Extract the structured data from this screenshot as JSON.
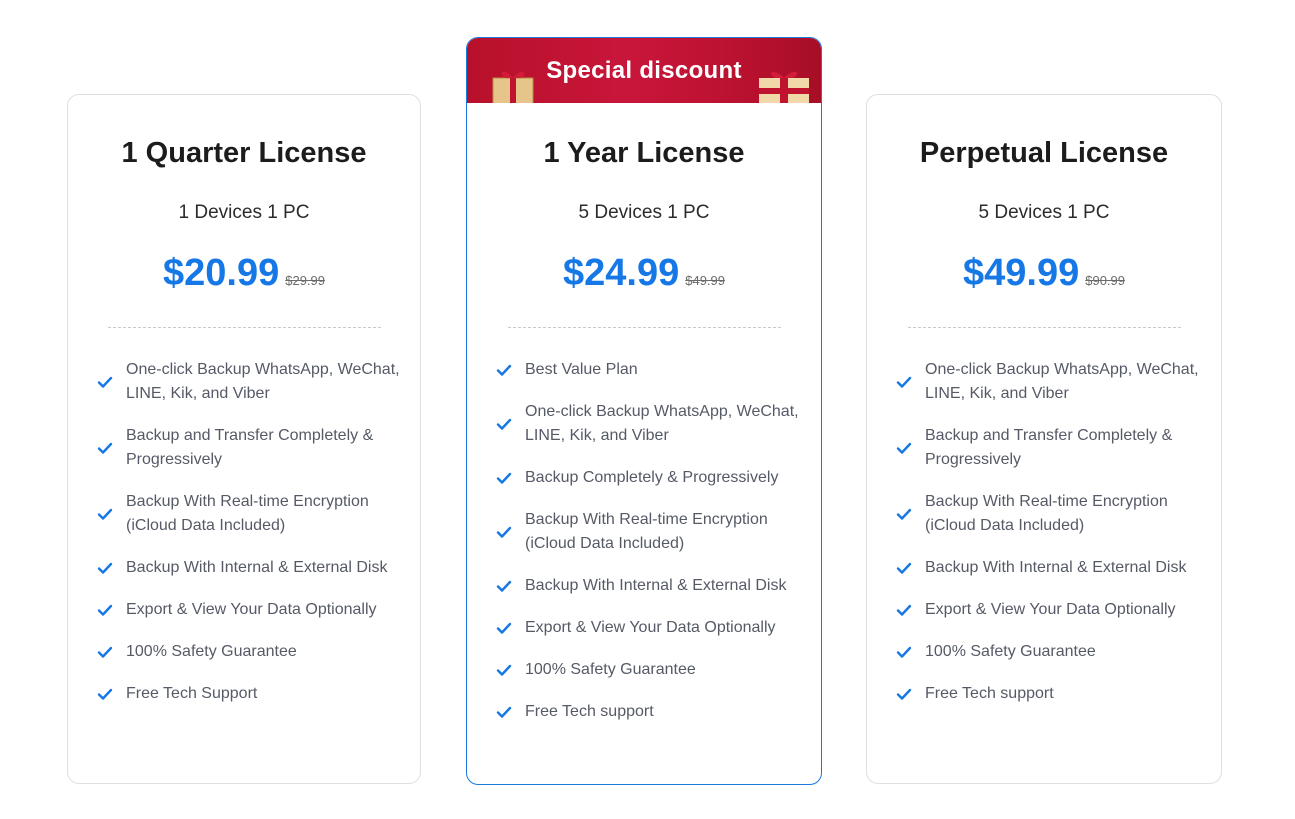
{
  "plans": [
    {
      "title": "1 Quarter License",
      "devices": "1 Devices 1 PC",
      "price": "$20.99",
      "old_price": "$29.99",
      "features": [
        "One-click Backup WhatsApp, WeChat, LINE, Kik, and Viber",
        "Backup and Transfer Completely & Progressively",
        "Backup With Real-time Encryption (iCloud Data Included)",
        "Backup With Internal & External Disk",
        "Export & View Your Data Optionally",
        "100% Safety Guarantee",
        "Free Tech Support"
      ]
    },
    {
      "banner": "Special discount",
      "title": "1 Year License",
      "devices": "5 Devices 1 PC",
      "price": "$24.99",
      "old_price": "$49.99",
      "features": [
        "Best Value Plan",
        "One-click Backup WhatsApp, WeChat, LINE, Kik, and Viber",
        "Backup Completely & Progressively",
        "Backup With Real-time Encryption (iCloud Data Included)",
        "Backup With Internal & External Disk",
        "Export & View Your Data Optionally",
        "100% Safety Guarantee",
        "Free Tech support"
      ]
    },
    {
      "title": "Perpetual License",
      "devices": "5 Devices 1 PC",
      "price": "$49.99",
      "old_price": "$90.99",
      "features": [
        "One-click Backup WhatsApp, WeChat, LINE, Kik, and Viber",
        "Backup and Transfer Completely & Progressively",
        "Backup With Real-time Encryption (iCloud Data Included)",
        "Backup With Internal & External Disk",
        "Export & View Your Data Optionally",
        "100% Safety Guarantee",
        "Free Tech support"
      ]
    }
  ],
  "colors": {
    "accent": "#1677e6",
    "banner": "#c8163a",
    "check": "#1677e6"
  },
  "icons": {
    "feature": "checkmark-icon",
    "banner_decoration": "gift-box-icon"
  }
}
